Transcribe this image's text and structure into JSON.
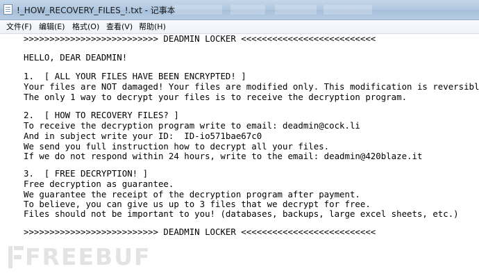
{
  "window": {
    "title": "!_HOW_RECOVERY_FILES_!.txt - 记事本",
    "icon": "notepad-icon"
  },
  "menu": {
    "items": [
      {
        "label": "文件(F)"
      },
      {
        "label": "编辑(E)"
      },
      {
        "label": "格式(O)"
      },
      {
        "label": "查看(V)"
      },
      {
        "label": "帮助(H)"
      }
    ]
  },
  "document": {
    "lines": [
      ">>>>>>>>>>>>>>>>>>>>>>>>>> DEADMIN LOCKER <<<<<<<<<<<<<<<<<<<<<<<<<<",
      "HELLO, DEAR DEADMIN!",
      "1.  [ ALL YOUR FILES HAVE BEEN ENCRYPTED! ]",
      "Your files are NOT damaged! Your files are modified only. This modification is reversible.",
      "The only 1 way to decrypt your files is to receive the decryption program.",
      "2.  [ HOW TO RECOVERY FILES? ]",
      "To receive the decryption program write to email: deadmin@cock.li",
      "And in subject write your ID:  ID-io571bae67c0",
      "We send you full instruction how to decrypt all your files.",
      "If we do not respond within 24 hours, write to the email: deadmin@420blaze.it",
      "3.  [ FREE DECRYPTION! ]",
      "Free decryption as guarantee.",
      "We guarantee the receipt of the decryption program after payment.",
      "To believe, you can give us up to 3 files that we decrypt for free.",
      "Files should not be important to you! (databases, backups, large excel sheets, etc.)",
      ">>>>>>>>>>>>>>>>>>>>>>>>>> DEADMIN LOCKER <<<<<<<<<<<<<<<<<<<<<<<<<<"
    ]
  },
  "watermark": {
    "text": "FREEBUF",
    "icon": "freebuf-logo-icon"
  }
}
